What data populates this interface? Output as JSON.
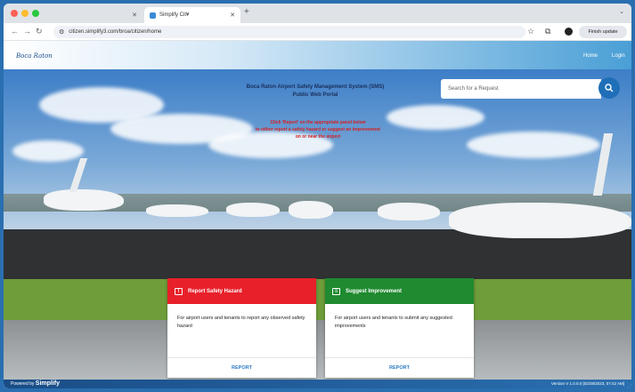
{
  "browser": {
    "tabs": [
      {
        "label": ""
      },
      {
        "label": "Simplify Cit¥"
      }
    ],
    "url": "citizen.simplify3.com/broa/citizen/home",
    "finish_update": "Finish update"
  },
  "site": {
    "logo_text": "Boca Raton",
    "nav": {
      "home": "Home",
      "login": "Login"
    }
  },
  "hero": {
    "title_line1": "Boca Raton Airport Safety Management System (SMS)",
    "title_line2": "Public Web Portal",
    "note_line1": "Click 'Report' on the appropriate panel below",
    "note_line2": "to either report a safety hazard or suggest an improvement",
    "note_line3": "on or near the airport",
    "search_placeholder": "Search for a Request"
  },
  "cards": [
    {
      "title": "Report Safety Hazard",
      "body": "For airport users and tenants to report any observed safety hazard",
      "action": "REPORT",
      "color": "#e8202a"
    },
    {
      "title": "Suggest Improvement",
      "body": "For airport users and tenants to submit any suggested improvements",
      "action": "REPORT",
      "color": "#1f8a2f"
    }
  ],
  "footer": {
    "powered_by": "Powered by",
    "brand": "Simplify",
    "version": "Version V 1.0.0.0 [02/28/2023, 07:42 AM]"
  }
}
